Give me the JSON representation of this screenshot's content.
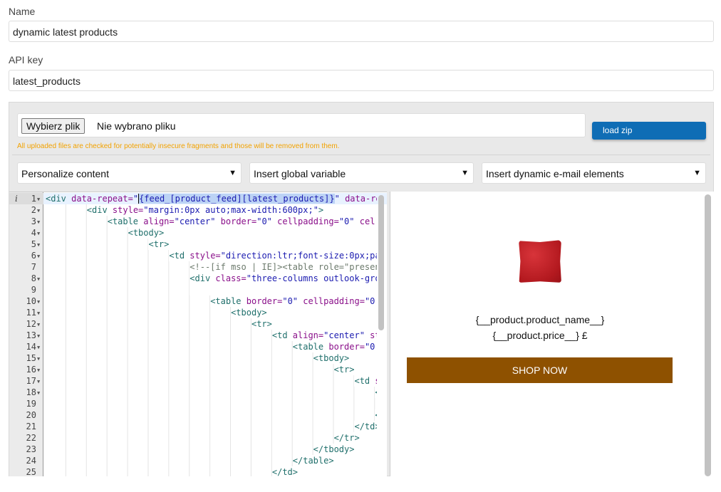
{
  "form": {
    "name_label": "Name",
    "name_value": "dynamic latest products",
    "api_key_label": "API key",
    "api_key_value": "latest_products"
  },
  "upload": {
    "choose_file_label": "Wybierz plik",
    "no_file_text": "Nie wybrano pliku",
    "load_zip_label": "load zip",
    "warning": "All uploaded files are checked for potentially insecure fragments and those will be removed from them.",
    "button_color": "#0f6db5",
    "warning_color": "#f2a200"
  },
  "selects": [
    {
      "label": "Personalize content"
    },
    {
      "label": "Insert global variable"
    },
    {
      "label": "Insert dynamic e-mail elements"
    }
  ],
  "editor": {
    "info_icon": "i",
    "lines": [
      {
        "n": "1",
        "indent": 0,
        "fold": true,
        "tokens": [
          [
            "tag",
            "<div"
          ],
          [
            "attr",
            " data-repeat="
          ],
          [
            "str",
            "\""
          ],
          [
            "hl",
            "{feed_[product_feed][latest_products]}"
          ],
          [
            "str",
            "\""
          ],
          [
            "attr",
            " data-re"
          ]
        ]
      },
      {
        "n": "2",
        "indent": 8,
        "fold": true,
        "tokens": [
          [
            "tag",
            "<div"
          ],
          [
            "attr",
            " style="
          ],
          [
            "str",
            "\"margin:0px auto;max-width:600px;\""
          ],
          [
            "tag",
            ">"
          ]
        ]
      },
      {
        "n": "3",
        "indent": 12,
        "fold": true,
        "tokens": [
          [
            "tag",
            "<table"
          ],
          [
            "attr",
            " align="
          ],
          [
            "str",
            "\"center\""
          ],
          [
            "attr",
            " border="
          ],
          [
            "str",
            "\"0\""
          ],
          [
            "attr",
            " cellpadding="
          ],
          [
            "str",
            "\"0\""
          ],
          [
            "attr",
            " cel"
          ]
        ]
      },
      {
        "n": "4",
        "indent": 16,
        "fold": true,
        "tokens": [
          [
            "tag",
            "<tbody>"
          ]
        ]
      },
      {
        "n": "5",
        "indent": 20,
        "fold": true,
        "tokens": [
          [
            "tag",
            "<tr>"
          ]
        ]
      },
      {
        "n": "6",
        "indent": 24,
        "fold": true,
        "tokens": [
          [
            "tag",
            "<td"
          ],
          [
            "attr",
            " style="
          ],
          [
            "str",
            "\"direction:ltr;font-size:0px;pa"
          ]
        ]
      },
      {
        "n": "7",
        "indent": 28,
        "fold": false,
        "tokens": [
          [
            "com",
            "<!--[if mso | IE]><table role=\"presen"
          ]
        ]
      },
      {
        "n": "8",
        "indent": 28,
        "fold": true,
        "tokens": [
          [
            "tag",
            "<div"
          ],
          [
            "attr",
            " class="
          ],
          [
            "str",
            "\"three-columns outlook-gro"
          ]
        ]
      },
      {
        "n": "9",
        "indent": 28,
        "fold": false,
        "tokens": []
      },
      {
        "n": "10",
        "indent": 32,
        "fold": true,
        "tokens": [
          [
            "tag",
            "<table"
          ],
          [
            "attr",
            " border="
          ],
          [
            "str",
            "\"0\""
          ],
          [
            "attr",
            " cellpadding="
          ],
          [
            "str",
            "\"0"
          ]
        ]
      },
      {
        "n": "11",
        "indent": 36,
        "fold": true,
        "tokens": [
          [
            "tag",
            "<tbody>"
          ]
        ]
      },
      {
        "n": "12",
        "indent": 40,
        "fold": true,
        "tokens": [
          [
            "tag",
            "<tr>"
          ]
        ]
      },
      {
        "n": "13",
        "indent": 44,
        "fold": true,
        "tokens": [
          [
            "tag",
            "<td"
          ],
          [
            "attr",
            " align="
          ],
          [
            "str",
            "\"center\""
          ],
          [
            "attr",
            " st"
          ]
        ]
      },
      {
        "n": "14",
        "indent": 48,
        "fold": true,
        "tokens": [
          [
            "tag",
            "<table"
          ],
          [
            "attr",
            " border="
          ],
          [
            "str",
            "\"0"
          ]
        ]
      },
      {
        "n": "15",
        "indent": 52,
        "fold": true,
        "tokens": [
          [
            "tag",
            "<tbody>"
          ]
        ]
      },
      {
        "n": "16",
        "indent": 56,
        "fold": true,
        "tokens": [
          [
            "tag",
            "<tr>"
          ]
        ]
      },
      {
        "n": "17",
        "indent": 60,
        "fold": true,
        "tokens": [
          [
            "tag",
            "<td"
          ],
          [
            "attr",
            " s"
          ]
        ]
      },
      {
        "n": "18",
        "indent": 64,
        "fold": true,
        "tokens": [
          [
            "tag",
            "<"
          ]
        ]
      },
      {
        "n": "19",
        "indent": 68,
        "fold": false,
        "tokens": []
      },
      {
        "n": "20",
        "indent": 64,
        "fold": false,
        "tokens": [
          [
            "tag",
            "<"
          ]
        ]
      },
      {
        "n": "21",
        "indent": 60,
        "fold": false,
        "tokens": [
          [
            "tag",
            "</td>"
          ]
        ]
      },
      {
        "n": "22",
        "indent": 56,
        "fold": false,
        "tokens": [
          [
            "tag",
            "</tr>"
          ]
        ]
      },
      {
        "n": "23",
        "indent": 52,
        "fold": false,
        "tokens": [
          [
            "tag",
            "</tbody>"
          ]
        ]
      },
      {
        "n": "24",
        "indent": 48,
        "fold": false,
        "tokens": [
          [
            "tag",
            "</table>"
          ]
        ]
      },
      {
        "n": "25",
        "indent": 44,
        "fold": false,
        "tokens": [
          [
            "tag",
            "</td>"
          ]
        ]
      }
    ]
  },
  "preview": {
    "product_name": "{__product.product_name__}",
    "product_price": "{__product.price__} £",
    "shop_button": "SHOP NOW",
    "shop_button_color": "#8e5100",
    "image": "red-pillow"
  }
}
